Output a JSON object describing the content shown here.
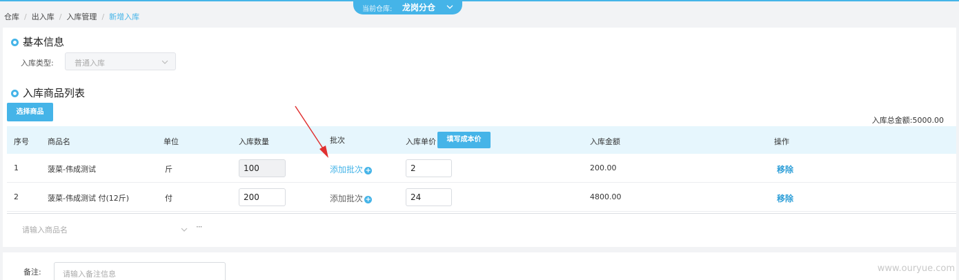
{
  "breadcrumb": {
    "items": [
      "仓库",
      "出入库",
      "入库管理"
    ],
    "current": "新增入库"
  },
  "warehouse": {
    "label": "当前仓库:",
    "value": "龙岗分仓"
  },
  "basic_info": {
    "title": "基本信息",
    "type_label": "入库类型:",
    "type_value": "普通入库"
  },
  "goods": {
    "title": "入库商品列表",
    "choose_button": "选择商品",
    "total_label": "入库总金额:",
    "total_value": "5000.00",
    "fill_cost_button": "填写成本价",
    "columns": {
      "index": "序号",
      "name": "商品名",
      "unit": "单位",
      "qty": "入库数量",
      "batch": "批次",
      "price": "入库单价",
      "amount": "入库金额",
      "ops": "操作"
    },
    "rows": [
      {
        "index": "1",
        "name": "菠菜-伟成测试",
        "unit": "斤",
        "qty": "100",
        "batch": "添加批次",
        "price": "2",
        "amount": "200.00",
        "remove": "移除"
      },
      {
        "index": "2",
        "name": "菠菜-伟成测试 付(12斤)",
        "unit": "付",
        "qty": "200",
        "batch": "添加批次",
        "price": "24",
        "amount": "4800.00",
        "remove": "移除"
      }
    ],
    "add_placeholder": "请输入商品名",
    "more": "···"
  },
  "remark": {
    "label": "备注:",
    "placeholder": "请输入备注信息"
  },
  "watermark": "www.ouryue.com",
  "colors": {
    "accent": "#45b4e8",
    "header_bg": "#e6f6fd",
    "annotation_arrow": "#e03030"
  }
}
